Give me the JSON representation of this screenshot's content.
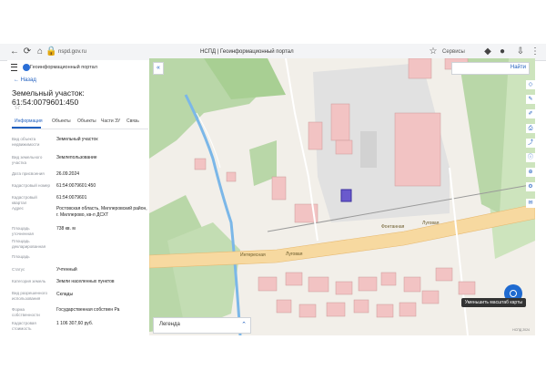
{
  "browser": {
    "url": "nspd.gov.ru",
    "tab_title": "НСПД | Геоинформационный портал",
    "right_label": "Сервисы"
  },
  "sidebar": {
    "header_title": "Геоинформационный портал",
    "back_label": "Назад",
    "parcel_title": "Земельный участок: 61:54:0079601:450",
    "tabs": [
      "Информация",
      "Объекты",
      "Объекты",
      "Части ЗУ",
      "Связь"
    ],
    "rows": [
      {
        "label": "Вид объекта недвижимости",
        "value": "Земельный участок"
      },
      {
        "label": "Вид земельного участка",
        "value": "Землепользование"
      },
      {
        "label": "Дата присвоения",
        "value": "26.09.2024"
      },
      {
        "label": "Кадастровый номер",
        "value": "61:54:0079601:450"
      },
      {
        "label": "Кадастровый квартал",
        "value": "61:54:0079601"
      },
      {
        "label": "Адрес",
        "value": "Ростовская область, Миллеровский район, г. Миллерово, кв-л ДСХТ"
      },
      {
        "label": "Площадь уточненная",
        "value": "738 кв. м"
      },
      {
        "label": "Площадь декларированная",
        "value": ""
      },
      {
        "label": "Площадь",
        "value": ""
      },
      {
        "label": "Статус",
        "value": "Учтенный"
      },
      {
        "label": "Категория земель",
        "value": "Земли населенных пунктов"
      },
      {
        "label": "Вид разрешенного использования",
        "value": "Склады"
      },
      {
        "label": "Форма собственности",
        "value": "Государственная собствен Ра"
      },
      {
        "label": "Кадастровая стоимость",
        "value": "1 106 307,60 руб."
      }
    ]
  },
  "map": {
    "search_button": "Найти",
    "legend_label": "Легенда",
    "zoom_tooltip": "Уменьшить масштаб карты",
    "attribution": "НСПД 2024",
    "road_labels": [
      "Интересная",
      "Луговая",
      "Фонтанная",
      "Луговая"
    ],
    "colors": {
      "accent": "#1f6ad0",
      "road": "#f7d9a0",
      "green": "#b9d7a8",
      "building": "#f2c3c3"
    }
  }
}
